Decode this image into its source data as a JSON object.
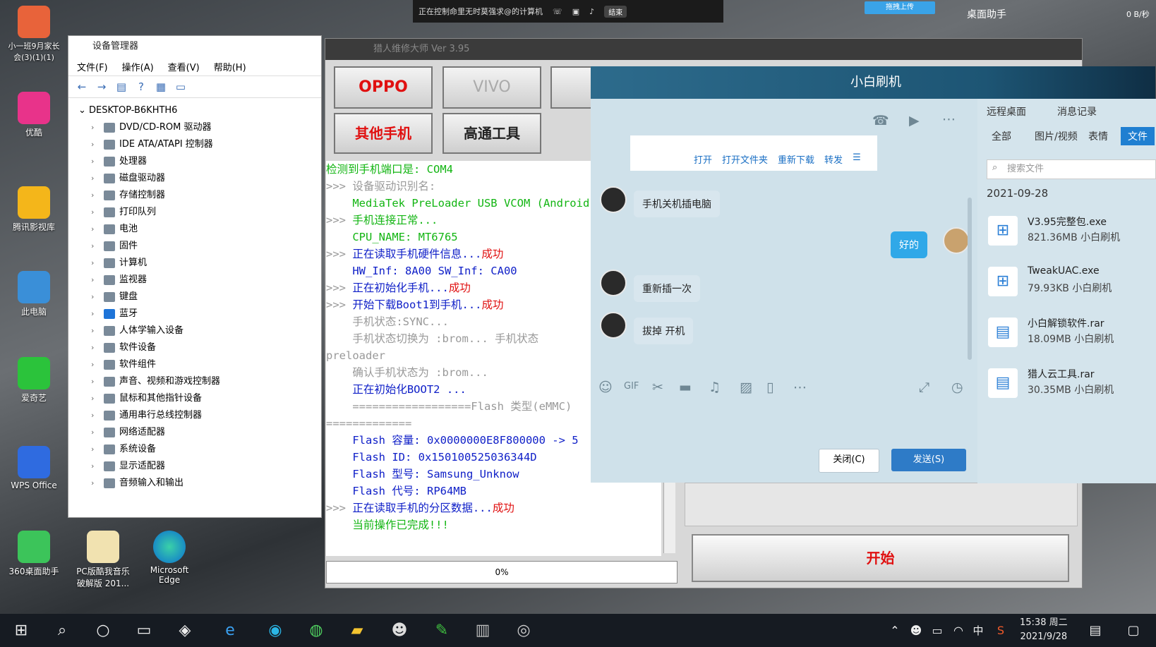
{
  "remote_bar": {
    "status": "正在控制命里无时莫强求@的计算机",
    "end_label": "结束"
  },
  "top_right": {
    "upload_label": "拖拽上传",
    "helper_label": "桌面助手",
    "speed": "0 B/秒"
  },
  "desktop_icons": [
    {
      "label": "小一班9月家长会(3)(1)(1)"
    },
    {
      "label": "优酷"
    },
    {
      "label": "腾讯影视库"
    },
    {
      "label": "此电脑"
    },
    {
      "label": "爱奇艺"
    },
    {
      "label": "WPS Office"
    },
    {
      "label": "360桌面助手"
    },
    {
      "label": "PC版酷我音乐破解版 201..."
    },
    {
      "label": "Microsoft Edge"
    }
  ],
  "device_manager": {
    "title": "设备管理器",
    "menu": [
      "文件(F)",
      "操作(A)",
      "查看(V)",
      "帮助(H)"
    ],
    "root": "DESKTOP-B6KHTH6",
    "items": [
      "DVD/CD-ROM 驱动器",
      "IDE ATA/ATAPI 控制器",
      "处理器",
      "磁盘驱动器",
      "存储控制器",
      "打印队列",
      "电池",
      "固件",
      "计算机",
      "监视器",
      "键盘",
      "蓝牙",
      "人体学输入设备",
      "软件设备",
      "软件组件",
      "声音、视频和游戏控制器",
      "鼠标和其他指针设备",
      "通用串行总线控制器",
      "网络适配器",
      "系统设备",
      "显示适配器",
      "音频输入和输出"
    ]
  },
  "flash_tool": {
    "title": "猎人维修大师 Ver 3.95",
    "buttons": {
      "oppo": "OPPO",
      "vivo": "VIVO",
      "other": "其他手机",
      "qualcomm": "高通工具"
    },
    "log": [
      {
        "prefix": "",
        "text": "检测到手机端口是:  COM4",
        "cls": "g"
      },
      {
        "prefix": ">>> ",
        "text": "设备驱动识别名:",
        "cls": "gr"
      },
      {
        "prefix": "    ",
        "text": "MediaTek PreLoader USB VCOM (Android)",
        "cls": "g"
      },
      {
        "prefix": ">>> ",
        "text": "手机连接正常...",
        "cls": "g"
      },
      {
        "prefix": "    ",
        "text": "CPU_NAME: MT6765",
        "cls": "g"
      },
      {
        "prefix": ">>> ",
        "text": "正在读取手机硬件信息...",
        "cls": "b",
        "suffix": "成功"
      },
      {
        "prefix": "    ",
        "text": "HW_Inf:  8A00   SW_Inf:  CA00",
        "cls": "b"
      },
      {
        "prefix": ">>> ",
        "text": "正在初始化手机...",
        "cls": "b",
        "suffix": "成功"
      },
      {
        "prefix": ">>> ",
        "text": "开始下载Boot1到手机...",
        "cls": "b",
        "suffix": "成功"
      },
      {
        "prefix": "    ",
        "text": "手机状态:SYNC...",
        "cls": "gr"
      },
      {
        "prefix": "    ",
        "text": "手机状态切换为 :brom...     手机状态",
        "cls": "gr"
      },
      {
        "prefix": "",
        "text": "preloader",
        "cls": "gr"
      },
      {
        "prefix": "    ",
        "text": "确认手机状态为 :brom...",
        "cls": "gr"
      },
      {
        "prefix": "    ",
        "text": "正在初始化BOOT2 ...",
        "cls": "b"
      },
      {
        "prefix": "    ",
        "text": "==================Flash 类型(eMMC)",
        "cls": "gr"
      },
      {
        "prefix": "",
        "text": "=============",
        "cls": "gr"
      },
      {
        "prefix": "    ",
        "text": "Flash 容量: 0x0000000E8F800000 -> 5",
        "cls": "b"
      },
      {
        "prefix": "    ",
        "text": "Flash  ID: 0x150100525036344D",
        "cls": "b"
      },
      {
        "prefix": "    ",
        "text": "Flash 型号: Samsung_Unknow",
        "cls": "b"
      },
      {
        "prefix": "    ",
        "text": "Flash 代号: RP64MB",
        "cls": "b"
      },
      {
        "prefix": ">>> ",
        "text": "正在读取手机的分区数据...",
        "cls": "b",
        "suffix": "成功"
      },
      {
        "prefix": "    ",
        "text": "当前操作已完成!!!",
        "cls": "g"
      }
    ],
    "progress": "0%",
    "start_label": "开始"
  },
  "chat": {
    "title": "小白刷机",
    "file_actions": [
      "打开",
      "打开文件夹",
      "重新下载",
      "转发"
    ],
    "messages": [
      {
        "from": "other",
        "text": "手机关机插电脑"
      },
      {
        "from": "me",
        "text": "好的"
      },
      {
        "from": "other",
        "text": "重新插一次"
      },
      {
        "from": "other",
        "text": "拔掉 开机"
      }
    ],
    "close_label": "关闭(C)",
    "send_label": "发送(S)"
  },
  "right_panel": {
    "tabs": [
      "远程桌面",
      "消息记录"
    ],
    "filters": [
      "全部",
      "图片/视频",
      "表情",
      "文件"
    ],
    "search_placeholder": "搜索文件",
    "date": "2021-09-28",
    "files": [
      {
        "name": "V3.95完整包.exe",
        "meta": "821.36MB 小白刷机"
      },
      {
        "name": "TweakUAC.exe",
        "meta": "79.93KB 小白刷机"
      },
      {
        "name": "小白解锁软件.rar",
        "meta": "18.09MB 小白刷机"
      },
      {
        "name": "猎人云工具.rar",
        "meta": "30.35MB 小白刷机"
      }
    ]
  },
  "taskbar": {
    "time": "15:38 周二",
    "date": "2021/9/28",
    "ime": "中"
  }
}
